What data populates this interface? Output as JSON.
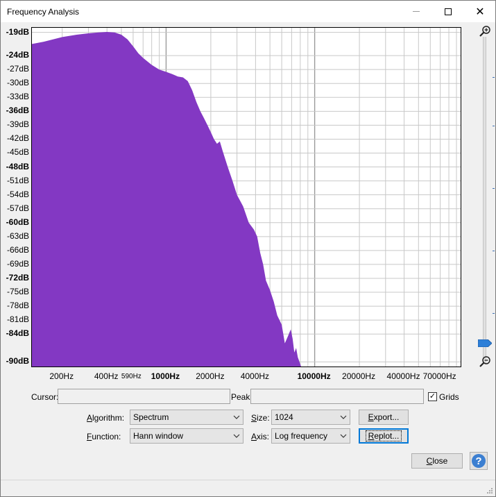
{
  "window": {
    "title": "Frequency Analysis",
    "minimize_glyph": "—",
    "close_glyph": "✕"
  },
  "plot": {
    "fill_color": "#8338c3",
    "grid_color": "#c8c8c8",
    "y_labels": [
      {
        "text": "-19dB",
        "db": -19,
        "bold": true
      },
      {
        "text": "-24dB",
        "db": -24,
        "bold": true
      },
      {
        "text": "-27dB",
        "db": -27,
        "bold": false
      },
      {
        "text": "-30dB",
        "db": -30,
        "bold": false
      },
      {
        "text": "-33dB",
        "db": -33,
        "bold": false
      },
      {
        "text": "-36dB",
        "db": -36,
        "bold": true
      },
      {
        "text": "-39dB",
        "db": -39,
        "bold": false
      },
      {
        "text": "-42dB",
        "db": -42,
        "bold": false
      },
      {
        "text": "-45dB",
        "db": -45,
        "bold": false
      },
      {
        "text": "-48dB",
        "db": -48,
        "bold": true
      },
      {
        "text": "-51dB",
        "db": -51,
        "bold": false
      },
      {
        "text": "-54dB",
        "db": -54,
        "bold": false
      },
      {
        "text": "-57dB",
        "db": -57,
        "bold": false
      },
      {
        "text": "-60dB",
        "db": -60,
        "bold": true
      },
      {
        "text": "-63dB",
        "db": -63,
        "bold": false
      },
      {
        "text": "-66dB",
        "db": -66,
        "bold": false
      },
      {
        "text": "-69dB",
        "db": -69,
        "bold": false
      },
      {
        "text": "-72dB",
        "db": -72,
        "bold": true
      },
      {
        "text": "-75dB",
        "db": -75,
        "bold": false
      },
      {
        "text": "-78dB",
        "db": -78,
        "bold": false
      },
      {
        "text": "-81dB",
        "db": -81,
        "bold": false
      },
      {
        "text": "-84dB",
        "db": -84,
        "bold": true
      },
      {
        "text": "-90dB",
        "db": -90,
        "bold": true
      }
    ],
    "x_labels": [
      {
        "text": "200Hz",
        "hz": 200,
        "bold": false,
        "small": false
      },
      {
        "text": "400Hz",
        "hz": 400,
        "bold": false,
        "small": false
      },
      {
        "text": "590Hz",
        "hz": 590,
        "bold": false,
        "small": true
      },
      {
        "text": "1000Hz",
        "hz": 1000,
        "bold": true,
        "small": false
      },
      {
        "text": "2000Hz",
        "hz": 2000,
        "bold": false,
        "small": false
      },
      {
        "text": "4000Hz",
        "hz": 4000,
        "bold": false,
        "small": false
      },
      {
        "text": "10000Hz",
        "hz": 10000,
        "bold": true,
        "small": false
      },
      {
        "text": "20000Hz",
        "hz": 20000,
        "bold": false,
        "small": false
      },
      {
        "text": "40000Hz",
        "hz": 40000,
        "bold": false,
        "small": false
      },
      {
        "text": "70000Hz",
        "hz": 70000,
        "bold": false,
        "small": false
      }
    ]
  },
  "chart_data": {
    "type": "area",
    "xscale": "log",
    "xlim": [
      125,
      96000
    ],
    "ylim": [
      -91,
      -18
    ],
    "x_unit": "Hz",
    "y_unit": "dB",
    "grid": true,
    "series": [
      {
        "x": [
          125,
          150,
          200,
          250,
          300,
          350,
          400,
          450,
          500,
          550,
          600,
          650,
          700,
          800,
          900,
          1000,
          1100,
          1200,
          1300,
          1400,
          1500,
          1600,
          1700,
          1800,
          1900,
          2000,
          2100,
          2200,
          2300,
          2400,
          2600,
          2800,
          3000,
          3300,
          3600,
          3900,
          4100,
          4300,
          4500,
          4700,
          5000,
          5300,
          5600,
          6000,
          6300,
          6600,
          6900,
          7100,
          7300,
          7500,
          7700,
          7900,
          8100,
          8300
        ],
        "y": [
          -21.5,
          -21.0,
          -20.0,
          -19.5,
          -19.2,
          -19.0,
          -18.9,
          -19.0,
          -19.5,
          -20.5,
          -22.0,
          -23.5,
          -24.5,
          -26.0,
          -27.0,
          -27.5,
          -28.0,
          -28.5,
          -28.7,
          -29.5,
          -31.5,
          -34.0,
          -36.0,
          -37.5,
          -39.0,
          -40.5,
          -42.0,
          -43.0,
          -42.5,
          -44.5,
          -48.0,
          -51.0,
          -54.0,
          -56.5,
          -60.0,
          -61.5,
          -63.0,
          -66.5,
          -69.0,
          -72.5,
          -74.5,
          -77.0,
          -80.0,
          -82.0,
          -86.0,
          -84.5,
          -83.0,
          -85.0,
          -88.0,
          -87.0,
          -89.0,
          -90.0,
          -91.0,
          -91.0
        ]
      }
    ]
  },
  "controls": {
    "cursor_label": "Cursor:",
    "cursor_value": "",
    "peak_label": "Peak:",
    "peak_value": "",
    "grids_checked_glyph": "✓",
    "grids_label": "Grids",
    "algorithm_label": "Algorithm:",
    "algorithm_value": "Spectrum",
    "size_label": "Size:",
    "size_value": "1024",
    "export_label": "Export...",
    "function_label": "Function:",
    "function_value": "Hann window",
    "axis_label": "Axis:",
    "axis_value": "Log frequency",
    "replot_label": "Replot...",
    "close_label": "Close",
    "help_glyph": "?"
  }
}
